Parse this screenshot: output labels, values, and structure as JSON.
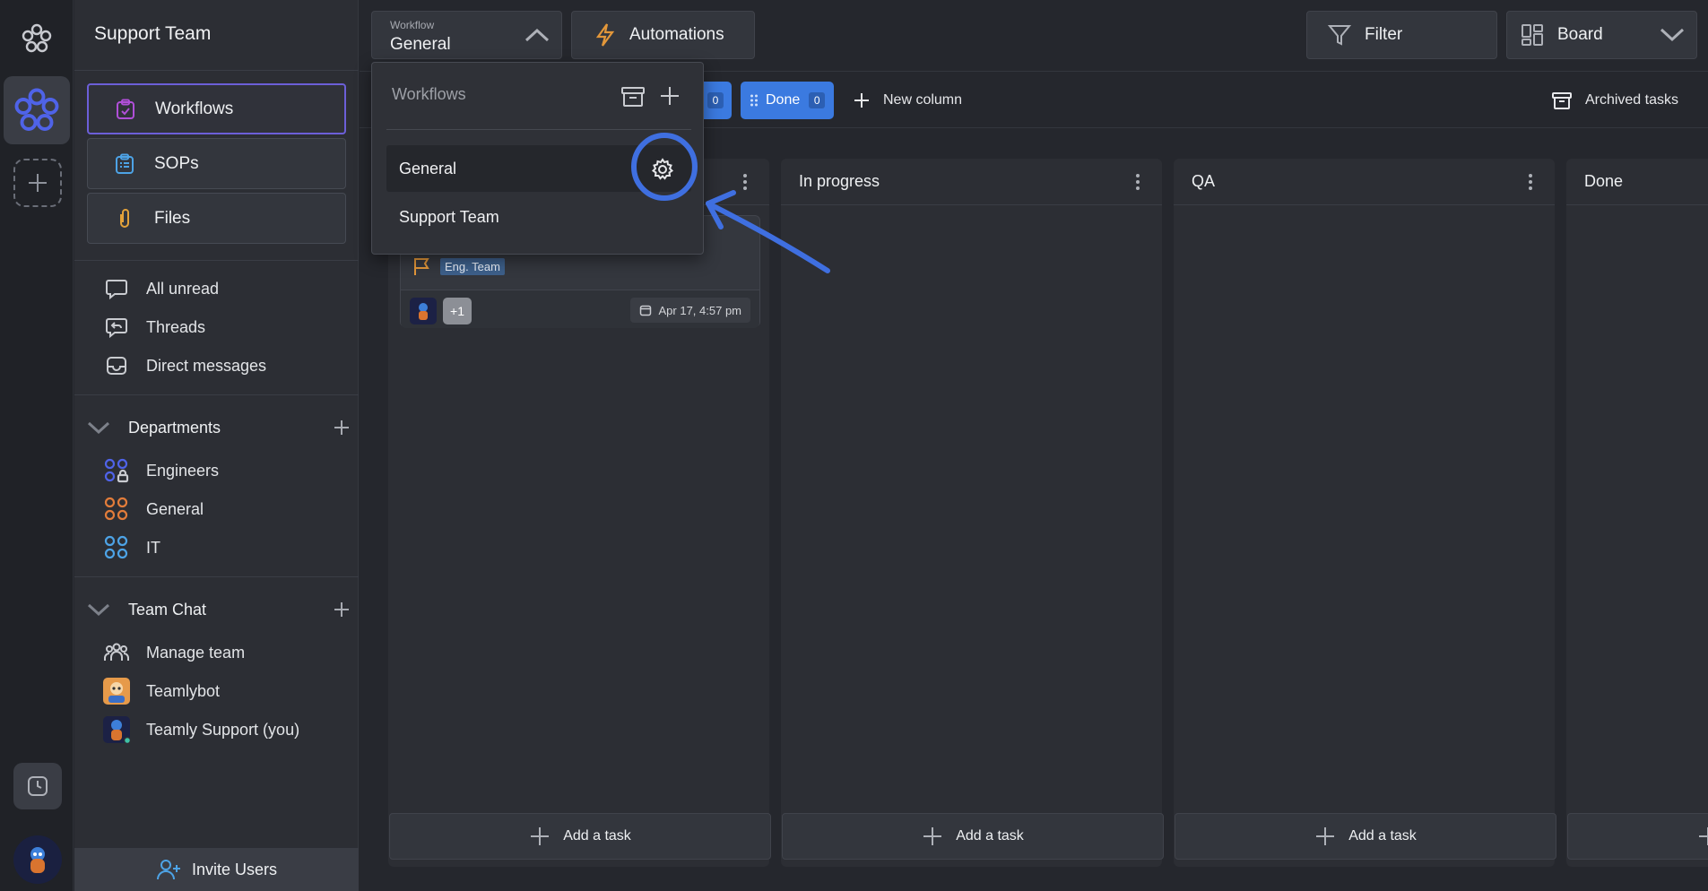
{
  "sidebar": {
    "team_name": "Support Team",
    "primary_nav": [
      {
        "label": "Workflows"
      },
      {
        "label": "SOPs"
      },
      {
        "label": "Files"
      }
    ],
    "inbox": [
      {
        "label": "All unread"
      },
      {
        "label": "Threads"
      },
      {
        "label": "Direct messages"
      }
    ],
    "departments": {
      "title": "Departments",
      "items": [
        {
          "label": "Engineers"
        },
        {
          "label": "General"
        },
        {
          "label": "IT"
        }
      ]
    },
    "team_chat": {
      "title": "Team Chat",
      "items": [
        {
          "label": "Manage team"
        },
        {
          "label": "Teamlybot"
        },
        {
          "label": "Teamly Support (you)"
        }
      ]
    },
    "invite_label": "Invite Users"
  },
  "topbar": {
    "workflow_caption": "Workflow",
    "workflow_value": "General",
    "automations_label": "Automations",
    "filter_label": "Filter",
    "view_label": "Board"
  },
  "column_tools": {
    "pill_partial_count": "0",
    "done_label": "Done",
    "done_count": "0",
    "new_column_label": "New column",
    "archived_label": "Archived tasks"
  },
  "dropdown": {
    "title": "Workflows",
    "items": [
      {
        "label": "General"
      },
      {
        "label": "Support Team"
      }
    ]
  },
  "board": {
    "columns": [
      {
        "title": ""
      },
      {
        "title": "In progress"
      },
      {
        "title": "QA"
      },
      {
        "title": "Done"
      }
    ],
    "add_task_label": "Add a task",
    "card": {
      "tag": "Eng. Team",
      "more_assignees": "+1",
      "due": "Apr 17, 4:57 pm"
    }
  },
  "colors": {
    "accent_blue": "#3b7ae0",
    "workflows_border": "#6c5fd8",
    "annotation_blue": "#3f6fe0"
  }
}
